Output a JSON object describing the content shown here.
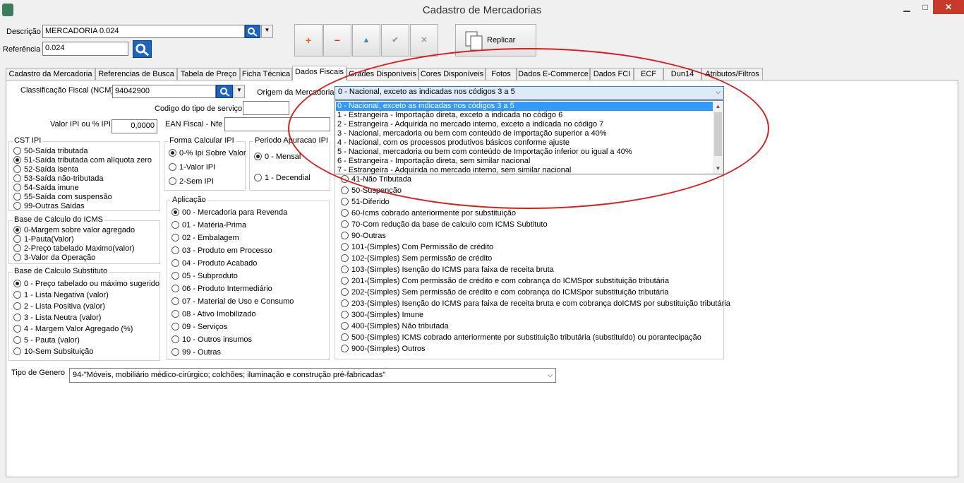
{
  "window": {
    "title": "Cadastro de Mercadorias",
    "minimize": "▁",
    "maximize": "□",
    "close": "✕"
  },
  "header": {
    "descricao_label": "Descrição",
    "descricao_value": "MERCADORIA 0.024",
    "referencia_label": "Referência",
    "referencia_value": "0.024"
  },
  "toolbar": {
    "add": "+",
    "remove": "−",
    "up": "▲",
    "confirm": "✔",
    "cancel": "✕",
    "replicar": "Replicar"
  },
  "tabs": [
    "Cadastro da Mercadoria",
    "Referencias de Busca",
    "Tabela de Preço",
    "Ficha Técnica",
    "Dados Fiscais",
    "Grades Disponíveis",
    "Cores Disponíveis",
    "Fotos",
    "Dados E-Commerce",
    "Dados FCI",
    "ECF",
    "Dun14",
    "Atributos/Filtros"
  ],
  "active_tab": "Dados Fiscais",
  "fiscal": {
    "ncm_label": "Classificação Fiscal (NCM)",
    "ncm_value": "94042900",
    "servico_label": "Codigo do tipo de serviço",
    "servico_value": "",
    "ipi_label": "Valor IPI ou % IPI",
    "ipi_value": "0,0000",
    "ean_label": "EAN Fiscal - Nfe",
    "ean_value": "",
    "origem_label": "Origem da Mercadoria",
    "origem_value": "0 - Nacional, exceto as indicadas nos códigos 3 a 5"
  },
  "origem_options": [
    "0 - Nacional, exceto as indicadas nos códigos 3 a 5",
    "1 - Estrangeira - Importação direta, exceto a indicada no código 6",
    "2 - Estrangeira - Adquirida no mercado interno, exceto a indicada no código 7",
    "3 -  Nacional, mercadoria ou bem com conteúdo de importação superior a 40%",
    "4 - Nacional, com os processos produtivos básicos conforme ajuste",
    "5 - Nacional, mercadoria ou bem com conteúdo de Importação inferior ou igual a 40%",
    "6 - Estrangeira - Importação direta, sem similar nacional",
    "7 - Estrangeira - Adquirida no mercado interno, sem similar nacional"
  ],
  "cst_ipi": {
    "title": "CST IPI",
    "options": [
      "50-Saída tributada",
      "51-Saída tributada com alíquota zero",
      "52-Saída isenta",
      "53-Saída não-tributada",
      "54-Saída imune",
      "55-Saída com suspensão",
      "99-Outras Saidas"
    ],
    "selected": 1
  },
  "forma_ipi": {
    "title": "Forma Calcular IPI",
    "options": [
      "0-% Ipi Sobre Valor",
      "1-Valor IPI",
      "2-Sem IPI"
    ],
    "selected": 0
  },
  "periodo_ipi": {
    "title": "Periodo Apuracao IPI",
    "options": [
      "0  - Mensal",
      "1  - Decendial"
    ],
    "selected": 0
  },
  "base_icms": {
    "title": "Base de Calculo do ICMS",
    "options": [
      "0-Margem sobre valor agregado",
      "1-Pauta(Valor)",
      "2-Preço tabelado Maximo(valor)",
      "3-Valor da Operação"
    ],
    "selected": 0
  },
  "base_subst": {
    "title": "Base de Calculo Substituto",
    "options": [
      "0 - Preço tabelado ou máximo sugerido",
      "1 - Lista Negativa (valor)",
      "2 - Lista Positiva (valor)",
      "3 - Lista Neutra (valor)",
      "4 - Margem Valor Agregado (%)",
      "5 - Pauta (valor)",
      "10-Sem Subsituição"
    ],
    "selected": 0
  },
  "aplicacao": {
    "title": "Aplicação",
    "options": [
      "00 - Mercadoria para Revenda",
      "01 - Matéria-Prima",
      "02 - Embalagem",
      "03 - Produto em Processo",
      "04 - Produto Acabado",
      "05 - Subproduto",
      "06 - Produto Intermediário",
      "07 - Material de Uso e Consumo",
      "08 - Ativo Imobilizado",
      "09 - Serviços",
      "10 - Outros insumos",
      "99 - Outras"
    ],
    "selected": 0
  },
  "cst_icms": {
    "options": [
      "41-Não Tributada",
      "50-Suspenção",
      "51-Diferido",
      "60-Icms cobrado anteriormente por substituição",
      "70-Com redução da base de calculo com ICMS Subtituto",
      "90-Outras",
      "101-(Simples) Com Permissão de crédito",
      "102-(Simples) Sem permissão de crédito",
      "103-(Simples) Isenção do ICMS para faixa de receita bruta",
      "201-(Simples) Com permissão de crédito e com cobrança do ICMSpor substituição tributária",
      "202-(Simples) Sem permissão de crédito e com cobrança do ICMSpor substituição tributária",
      "203-(Simples) Isenção do ICMS para faixa de receita bruta e com cobrança doICMS por substituição tributária",
      "300-(Simples) Imune",
      "400-(Simples) Não tributada",
      "500-(Simples) ICMS cobrado anteriormente por substituição tributária (substituído) ou porantecipação",
      "900-(Simples) Outros"
    ]
  },
  "genero": {
    "label": "Tipo de Genero",
    "value": "94-\"Móveis, mobiliário médico-cirúrgico; colchões; iluminação e construção pré-fabricadas\""
  },
  "colors": {
    "accent": "#1c63c6",
    "selection": "#3399ff",
    "annotation": "#d81e1e",
    "close": "#c7392a"
  }
}
